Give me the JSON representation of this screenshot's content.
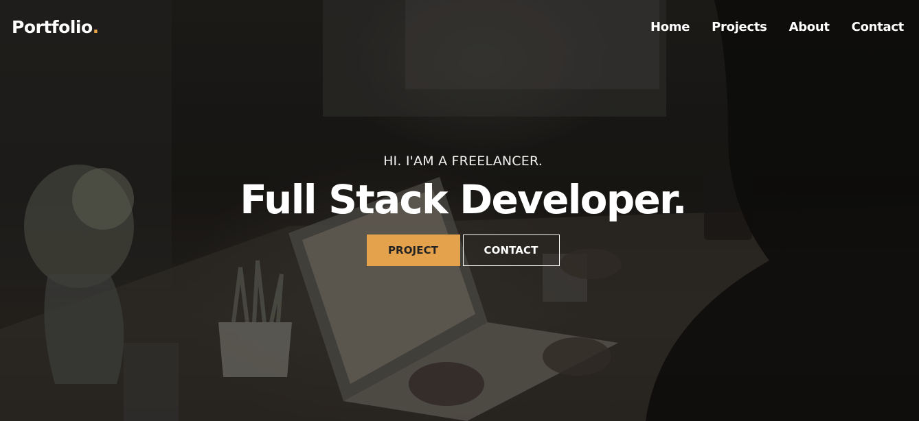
{
  "brand": {
    "name": "Portfolio",
    "dot": "."
  },
  "nav": {
    "items": [
      {
        "label": "Home"
      },
      {
        "label": "Projects"
      },
      {
        "label": "About"
      },
      {
        "label": "Contact"
      }
    ]
  },
  "hero": {
    "subtitle": "HI. I'AM A FREELANCER.",
    "title": "Full Stack Developer.",
    "primary_button": "PROJECT",
    "secondary_button": "CONTACT"
  },
  "colors": {
    "accent": "#e4a24c",
    "text": "#ffffff",
    "background": "#1c1a17"
  }
}
